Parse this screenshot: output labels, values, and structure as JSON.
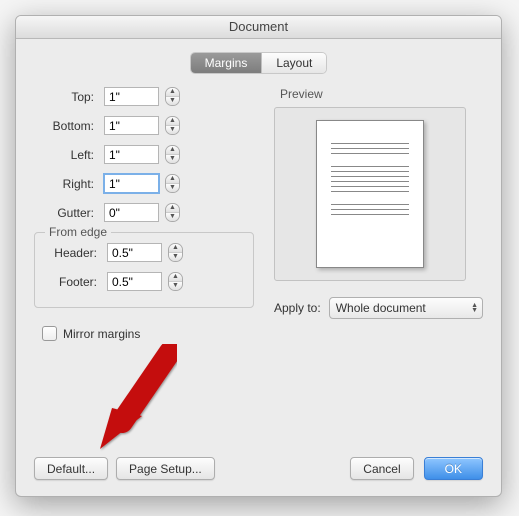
{
  "window": {
    "title": "Document"
  },
  "tabs": {
    "margins": "Margins",
    "layout": "Layout"
  },
  "margins": {
    "top": {
      "label": "Top:",
      "value": "1\""
    },
    "bottom": {
      "label": "Bottom:",
      "value": "1\""
    },
    "left": {
      "label": "Left:",
      "value": "1\""
    },
    "right": {
      "label": "Right:",
      "value": "1\""
    },
    "gutter": {
      "label": "Gutter:",
      "value": "0\""
    }
  },
  "from_edge": {
    "legend": "From edge",
    "header": {
      "label": "Header:",
      "value": "0.5\""
    },
    "footer": {
      "label": "Footer:",
      "value": "0.5\""
    }
  },
  "mirror": {
    "label": "Mirror margins",
    "checked": false
  },
  "preview": {
    "label": "Preview"
  },
  "apply_to": {
    "label": "Apply to:",
    "value": "Whole document"
  },
  "buttons": {
    "default": "Default...",
    "page_setup": "Page Setup...",
    "cancel": "Cancel",
    "ok": "OK"
  }
}
